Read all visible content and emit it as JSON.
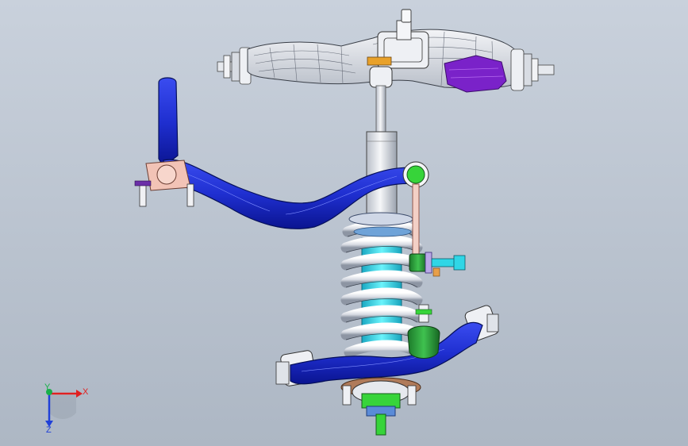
{
  "viewport": {
    "background_top": "#c9d1dc",
    "background_bottom": "#adb7c4"
  },
  "colors": {
    "stabilizer_bar": "#1f2fd0",
    "stabilizer_bar_dark": "#0a1490",
    "spring": "#e6e9ef",
    "damper_body": "#2ee4f0",
    "strut_rod": "#e8ebf0",
    "ball_joint": "#2a9c3a",
    "bushing": "#f2c3b6",
    "link_rod": "#f3d0c6",
    "bolt": "#30d6e6",
    "top_mount_purple": "#7a22c9",
    "hub_green": "#37d43a",
    "brown_plate": "#b07b5a",
    "orange_accent": "#e8a12a"
  },
  "triad": {
    "x_label": "X",
    "y_label": "Y",
    "z_label": "Z",
    "x_color": "#e02020",
    "y_color": "#18b04a",
    "z_color": "#2040d8"
  }
}
